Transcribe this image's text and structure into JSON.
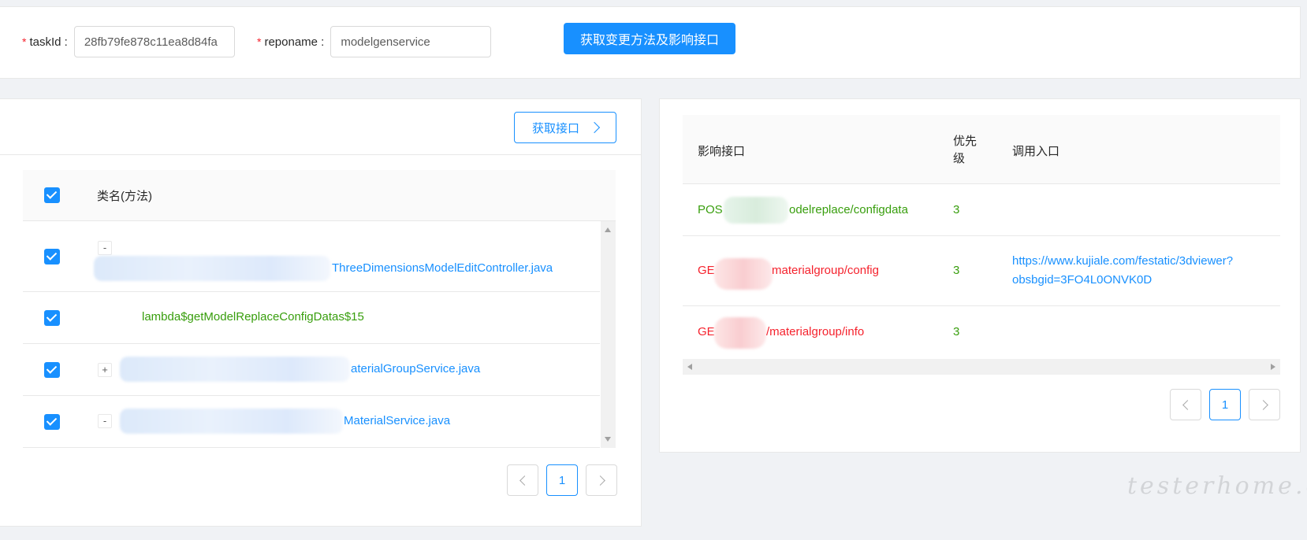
{
  "form": {
    "taskid_required_mark": "*",
    "taskid_label": "taskId :",
    "taskid_value": "28fb79fe878c11ea8d84fa",
    "reponame_required_mark": "*",
    "reponame_label": "reponame :",
    "reponame_value": "modelgenservice",
    "submit_label": "获取变更方法及影响接口"
  },
  "left": {
    "get_api_label": "获取接口",
    "header": "类名(方法)",
    "rows": [
      {
        "expander": "-",
        "text": "ThreeDimensionsModelEditController.java",
        "color": "#1890ff"
      },
      {
        "expander": "",
        "text": "lambda$getModelReplaceConfigDatas$15",
        "color": "#389e0d"
      },
      {
        "expander": "+",
        "text": "aterialGroupService.java",
        "color": "#1890ff"
      },
      {
        "expander": "-",
        "text": "MaterialService.java",
        "color": "#1890ff"
      }
    ],
    "pager": {
      "current": "1"
    }
  },
  "right": {
    "headers": {
      "api": "影响接口",
      "priority": "优先级",
      "entry": "调用入口"
    },
    "rows": [
      {
        "api_prefix": "POS",
        "api_suffix": "odelreplace/configdata",
        "api_color": "#389e0d",
        "priority": "3",
        "entry": ""
      },
      {
        "api_prefix": "GE",
        "api_suffix": "materialgroup/config",
        "api_color": "#f5222d",
        "priority": "3",
        "entry_line1": "https://www.kujiale.com/festatic/3dviewer?",
        "entry_line2": "obsbgid=3FO4L0ONVK0D"
      },
      {
        "api_prefix": "GE",
        "api_suffix": "/materialgroup/info",
        "api_color": "#f5222d",
        "priority": "3",
        "entry": ""
      }
    ],
    "pager": {
      "current": "1"
    }
  },
  "watermark": "testerhome.com"
}
